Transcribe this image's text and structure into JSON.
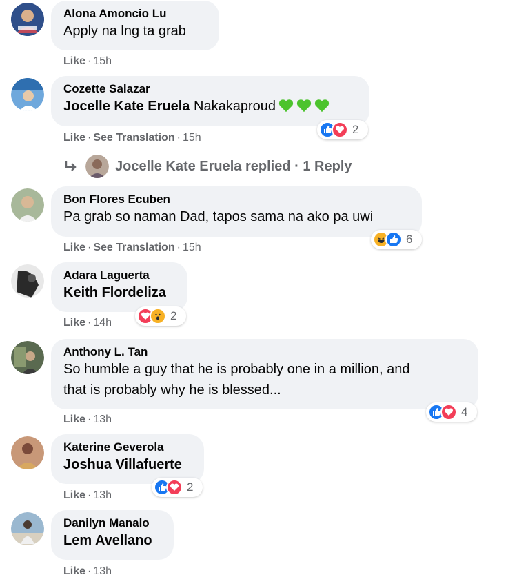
{
  "comments": [
    {
      "name": "Alona Amoncio Lu",
      "text": "Apply na lng ta grab",
      "mention": "",
      "like": "Like",
      "translate": "",
      "time": "15h",
      "reactions": [],
      "reaction_count": "",
      "avatar_color": "#3b5998"
    },
    {
      "name": "Cozette Salazar",
      "text": "Nakakaproud",
      "mention": "Jocelle Kate Eruela",
      "like": "Like",
      "translate": "See Translation",
      "time": "15h",
      "reactions": [
        "like",
        "love"
      ],
      "reaction_count": "2",
      "emoji": [
        "green-heart",
        "green-heart",
        "green-heart"
      ],
      "avatar_color": "#4a7fb5"
    },
    {
      "name": "Bon Flores Ecuben",
      "text": "Pa grab so naman Dad, tapos sama na ako pa uwi",
      "mention": "",
      "like": "Like",
      "translate": "See Translation",
      "time": "15h",
      "reactions": [
        "haha",
        "like"
      ],
      "reaction_count": "6",
      "avatar_color": "#8a9a7a"
    },
    {
      "name": "Adara Laguerta",
      "text": "",
      "mention": "Keith Flordeliza",
      "like": "Like",
      "translate": "",
      "time": "14h",
      "reactions": [
        "love",
        "wow"
      ],
      "reaction_count": "2",
      "avatar_color": "#333333"
    },
    {
      "name": "Anthony L. Tan",
      "text_lines": [
        "So humble a guy that he is probably one in a million, and",
        "that is probably why he is blessed..."
      ],
      "mention": "",
      "like": "Like",
      "translate": "",
      "time": "13h",
      "reactions": [
        "like",
        "love"
      ],
      "reaction_count": "4",
      "avatar_color": "#5a6a50"
    },
    {
      "name": "Katerine Geverola",
      "text": "",
      "mention": "Joshua Villafuerte",
      "like": "Like",
      "translate": "",
      "time": "13h",
      "reactions": [
        "like",
        "love"
      ],
      "reaction_count": "2",
      "avatar_color": "#a0705a"
    },
    {
      "name": "Danilyn Manalo",
      "text": "",
      "mention": "Lem Avellano",
      "like": "Like",
      "translate": "",
      "time": "13h",
      "reactions": [],
      "reaction_count": "",
      "avatar_color": "#7a9ab0"
    }
  ],
  "reply": {
    "author": "Jocelle Kate Eruela",
    "label": "replied",
    "count": "1 Reply",
    "separator": "·"
  },
  "colors": {
    "bubble": "#f0f2f5",
    "meta": "#65676b",
    "like": "#1877f2",
    "love": "#f33e58",
    "haha": "#f7b125"
  }
}
